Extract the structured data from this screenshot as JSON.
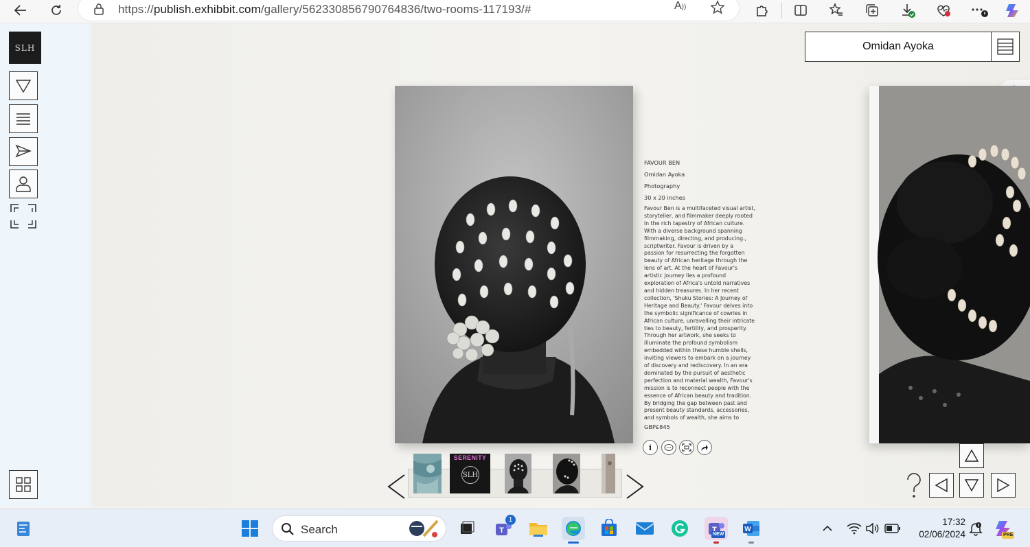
{
  "browser": {
    "url_prefix": "https://",
    "url_domain": "publish.exhibbit.com",
    "url_path": "/gallery/562330856790764836/two-rooms-117193/#",
    "read_aloud_label": "A"
  },
  "sidebar": {
    "logo_text": "SLH"
  },
  "header": {
    "artist_name": "Omidan Ayoka"
  },
  "artwork": {
    "title": "FAVOUR BEN",
    "artist": "Omidan Ayoka",
    "medium": "Photography",
    "size": "30 x 20 inches",
    "description": "Favour Ben is a multifaceted visual artist, storyteller, and filmmaker deeply rooted in the rich tapestry of African culture. With a diverse background spanning filmmaking, directing, and producing., scriptwriter. Favour is driven by a passion for resurrecting the forgotten beauty of African heritage through the lens of art. At the heart of Favour's artistic journey lies a profound exploration of Africa's untold narratives and hidden treasures. In her recent collection, 'Shuku Stories: A Journey of Heritage and Beauty.' Favour delves into the symbolic significance of cowries in African culture, unravelling their intricate ties to beauty, fertility, and prosperity. Through her artwork, she seeks to illuminate the profound symbolism embedded within these humble shells, inviting viewers to embark on a journey of discovery and rediscovery. In an era dominated by the pursuit of aesthetic perfection and material wealth, Favour's mission is to reconnect people with the essence of African beauty and tradition. By bridging the gap between past and present beauty standards, accessories, and symbols of wealth, she aims to",
    "price": "GBP£845"
  },
  "thumbnails": {
    "serenity_label": "SERENITY",
    "serenity_logo": "SLH"
  },
  "taskbar": {
    "search_label": "Search",
    "teams_badge": "1",
    "new_badge": "NEW",
    "pre_badge": "PRE",
    "time": "17:32",
    "date": "02/06/2024"
  }
}
